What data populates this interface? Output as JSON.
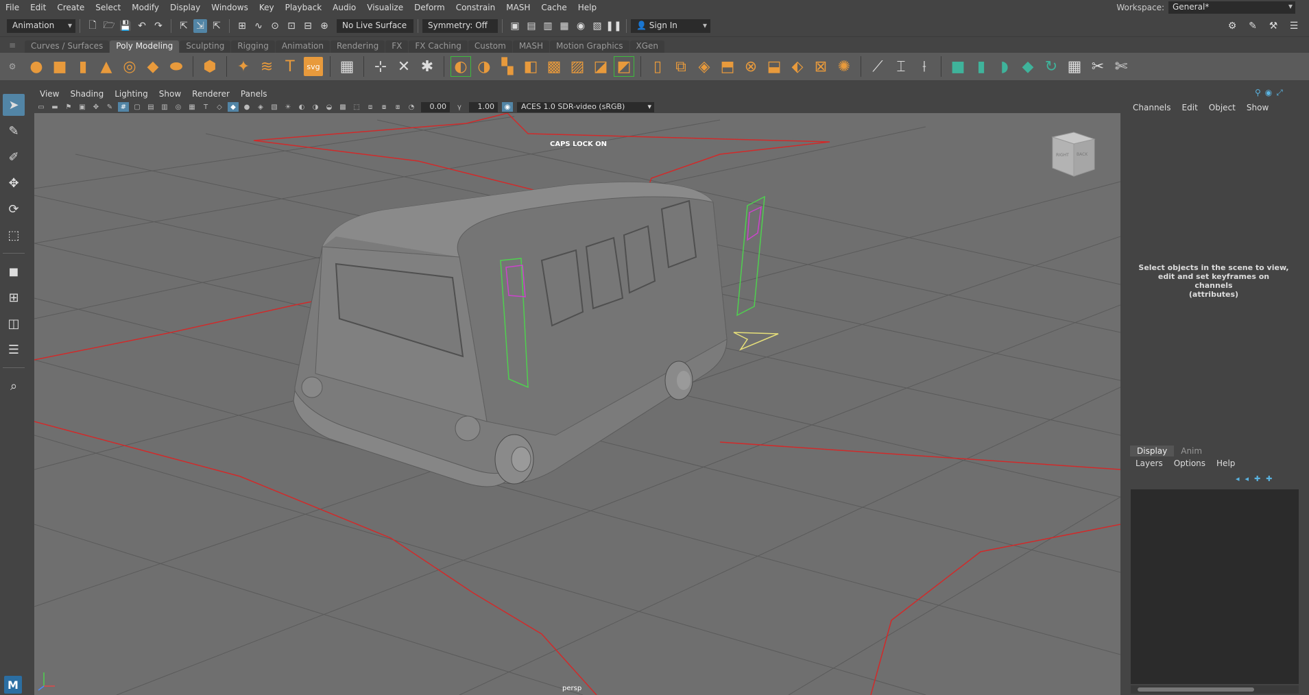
{
  "menubar": {
    "items": [
      "File",
      "Edit",
      "Create",
      "Select",
      "Modify",
      "Display",
      "Windows",
      "Key",
      "Playback",
      "Audio",
      "Visualize",
      "Deform",
      "Constrain",
      "MASH",
      "Cache",
      "Help"
    ],
    "workspace_label": "Workspace:",
    "workspace_value": "General*"
  },
  "statusline": {
    "menuset": "Animation",
    "live_surface": "No Live Surface",
    "symmetry": "Symmetry: Off",
    "sign_in": "Sign In"
  },
  "shelf": {
    "tabs": [
      "Curves / Surfaces",
      "Poly Modeling",
      "Sculpting",
      "Rigging",
      "Animation",
      "Rendering",
      "FX",
      "FX Caching",
      "Custom",
      "MASH",
      "Motion Graphics",
      "XGen"
    ],
    "active_tab": "Poly Modeling"
  },
  "viewport": {
    "menu": [
      "View",
      "Shading",
      "Lighting",
      "Show",
      "Renderer",
      "Panels"
    ],
    "exposure": "0.00",
    "gamma": "1.00",
    "color_management": "ACES 1.0 SDR-video (sRGB)",
    "caps_lock": "CAPS LOCK ON",
    "camera": "persp",
    "viewcube_right": "RIGHT",
    "viewcube_back": "BACK"
  },
  "channelbox": {
    "menu": [
      "Channels",
      "Edit",
      "Object",
      "Show"
    ],
    "message_lines": [
      "Select objects in the scene to view,",
      "edit and set keyframes on channels",
      "(attributes)"
    ]
  },
  "layereditor": {
    "tabs": [
      "Display",
      "Anim"
    ],
    "menu": [
      "Layers",
      "Options",
      "Help"
    ]
  },
  "icons": {
    "tools": [
      "select-tool-icon",
      "lasso-tool-icon",
      "paint-select-icon",
      "move-tool-icon",
      "rotate-tool-icon",
      "scale-tool-icon"
    ],
    "accent": "#5285a6",
    "shelf_orange": "#e89a3c"
  }
}
